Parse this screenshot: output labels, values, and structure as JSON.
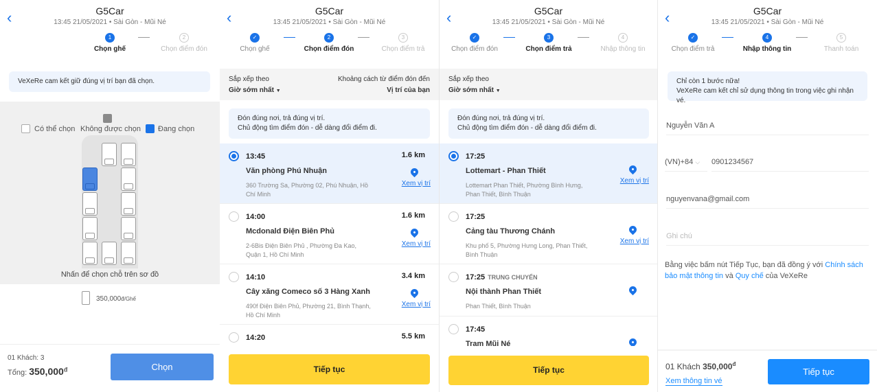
{
  "header": {
    "title": "G5Car",
    "subtitle": "13:45 21/05/2021 • Sài Gòn - Mũi Né"
  },
  "colors": {
    "primary": "#1a73e8",
    "yellow_button": "#ffd333",
    "selected_row": "#eaf2fd",
    "seat_selected": "#4a86e0"
  },
  "seat_screen": {
    "steps": [
      {
        "num": "1",
        "label": "Chọn ghế"
      },
      {
        "num": "2",
        "label": "Chọn điểm đón"
      }
    ],
    "notice": "VeXeRe cam kết giữ đúng vị trí bạn đã chọn.",
    "legend": {
      "available": "Có thể chọn",
      "unavailable": "Không được chọn",
      "selected": "Đang chọn"
    },
    "hint": "Nhấn để chọn chỗ trên sơ đồ",
    "price": "350,000",
    "price_unit": "đ/Ghế",
    "seats": [
      [
        "empty",
        "available",
        "available"
      ],
      [
        "selected",
        "empty",
        "available"
      ],
      [
        "available",
        "empty",
        "available"
      ],
      [
        "available",
        "empty",
        "available"
      ],
      [
        "available",
        "available",
        "available"
      ]
    ],
    "footer": {
      "passengers": "01 Khách: 3",
      "total_label": "Tổng:",
      "total": "350,000",
      "currency": "đ",
      "button": "Chọn"
    }
  },
  "pickup_screen": {
    "steps": [
      {
        "num": "✓",
        "label": "Chọn ghế"
      },
      {
        "num": "2",
        "label": "Chọn điểm đón"
      },
      {
        "num": "3",
        "label": "Chọn điểm trả"
      }
    ],
    "sort_label": "Sắp xếp theo",
    "sort_value": "Giờ sớm nhất",
    "distance_label": "Khoảng cách từ điểm đón đến",
    "distance_value": "Vị trí của bạn",
    "notice_line1": "Đón đúng nơi, trả đúng vị trí.",
    "notice_line2": "Chủ động tìm điểm đón - dễ dàng đổi điểm đi.",
    "items": [
      {
        "time": "13:45",
        "name": "Văn phòng Phú Nhuận",
        "address": "360 Trường Sa, Phường 02, Phú Nhuận, Hồ Chí Minh",
        "distance": "1.6 km",
        "link": "Xem vị trí",
        "selected": true
      },
      {
        "time": "14:00",
        "name": "Mcdonald Điện Biên Phủ",
        "address": "2-6Bis Điện Biên Phủ , Phường Đa Kao, Quận 1, Hồ Chí Minh",
        "distance": "1.6 km",
        "link": "Xem vị trí"
      },
      {
        "time": "14:10",
        "name": "Cây xăng Comeco số 3 Hàng Xanh",
        "address": "490f Điện Biên Phủ, Phường 21, Bình Thạnh, Hồ Chí Minh",
        "distance": "3.4 km",
        "link": "Xem vị trí"
      },
      {
        "time": "14:20",
        "name": "",
        "address": "",
        "distance": "5.5 km",
        "link": ""
      }
    ],
    "button": "Tiếp tục"
  },
  "dropoff_screen": {
    "steps": [
      {
        "num": "✓",
        "label": "Chọn điểm đón"
      },
      {
        "num": "3",
        "label": "Chọn điểm trả"
      },
      {
        "num": "4",
        "label": "Nhập thông tin"
      }
    ],
    "sort_label": "Sắp xếp theo",
    "sort_value": "Giờ sớm nhất",
    "notice_line1": "Đón đúng nơi, trả đúng vị trí.",
    "notice_line2": "Chủ động tìm điểm đón - dễ dàng đổi điểm đi.",
    "items": [
      {
        "time": "17:25",
        "name": "Lottemart - Phan Thiết",
        "address": "Lottemart Phan Thiết, Phường Bình Hưng, Phan Thiết, Bình Thuận",
        "link": "Xem vị trí",
        "selected": true
      },
      {
        "time": "17:25",
        "name": "Cảng tàu Thương Chánh",
        "address": "Khu phố 5, Phường Hưng Long, Phan Thiết, Bình Thuận",
        "link": "Xem vị trí"
      },
      {
        "time": "17:25",
        "tag": "TRUNG CHUYỂN",
        "name": "Nội thành Phan Thiết",
        "address": "Phan Thiết, Bình Thuận",
        "link": ""
      },
      {
        "time": "17:45",
        "name": "Trạm Mũi Né",
        "address": "",
        "link": ""
      }
    ],
    "button": "Tiếp tục"
  },
  "info_screen": {
    "steps": [
      {
        "num": "✓",
        "label": "Chọn điểm trả"
      },
      {
        "num": "4",
        "label": "Nhập thông tin"
      },
      {
        "num": "5",
        "label": "Thanh toán"
      }
    ],
    "notice_line1": "Chỉ còn 1 bước nữa!",
    "notice_line2": "VeXeRe cam kết chỉ sử dụng thông tin trong việc ghi nhận vé.",
    "name_value": "Nguyễn Văn A",
    "country_code": "(VN)+84",
    "phone_value": "0901234567",
    "email_value": "nguyenvana@gmail.com",
    "note_placeholder": "Ghi chú",
    "terms": {
      "prefix": "Bằng việc bấm nút Tiếp Tục, bạn đã đồng ý với ",
      "policy_link": "Chính sách bảo mật thông tin",
      "middle": " và ",
      "rules_link": "Quy chế",
      "suffix": " của VeXeRe"
    },
    "footer": {
      "passengers": "01 Khách",
      "total": "350,000",
      "currency": "đ",
      "details_link": "Xem thông tin vé",
      "button": "Tiếp tục"
    }
  }
}
